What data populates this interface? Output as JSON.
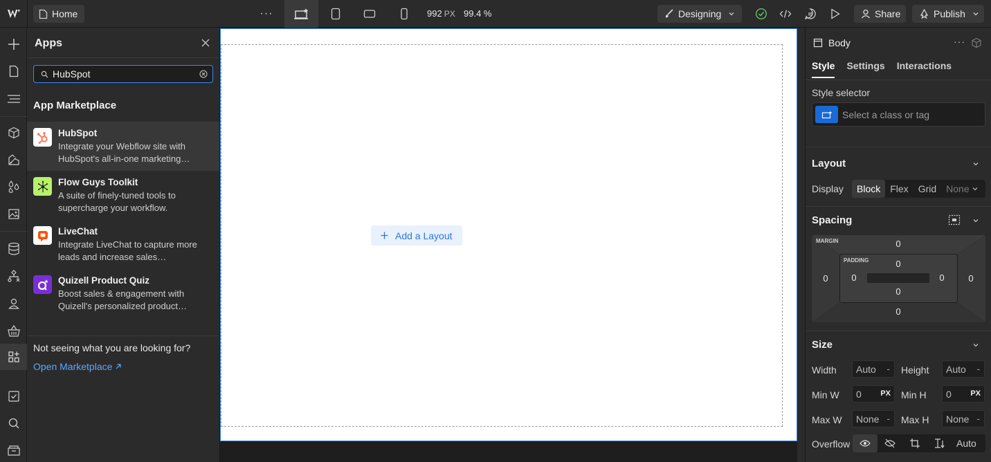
{
  "topbar": {
    "home_label": "Home",
    "more": "···",
    "viewport_width": "992",
    "viewport_unit": "PX",
    "zoom": "99.4 %",
    "mode_label": "Designing",
    "share_label": "Share",
    "publish_label": "Publish"
  },
  "apps_panel": {
    "title": "Apps",
    "search_value": "HubSpot",
    "section_title": "App Marketplace",
    "items": [
      {
        "name": "HubSpot",
        "desc": "Integrate your Webflow site with HubSpot's all-in-one marketing…",
        "color": "#ff7a59"
      },
      {
        "name": "Flow Guys Toolkit",
        "desc": "A suite of finely-tuned tools to supercharge your workflow.",
        "color": "#b7f06b"
      },
      {
        "name": "LiveChat",
        "desc": "Integrate LiveChat to capture more leads and increase sales…",
        "color": "#ff5100"
      },
      {
        "name": "Quizell Product Quiz",
        "desc": "Boost sales & engagement with Quizell's personalized product…",
        "color": "#7a2fd6"
      }
    ],
    "footer_text": "Not seeing what you are looking for?",
    "footer_link": "Open Marketplace"
  },
  "canvas": {
    "add_layout_label": "Add a Layout"
  },
  "right_panel": {
    "selected": "Body",
    "more": "···",
    "tabs": [
      "Style",
      "Settings",
      "Interactions"
    ],
    "style_selector_label": "Style selector",
    "style_selector_placeholder": "Select a class or tag",
    "layout": {
      "title": "Layout",
      "display_label": "Display",
      "options": [
        "Block",
        "Flex",
        "Grid",
        "None"
      ]
    },
    "spacing": {
      "title": "Spacing",
      "margin_label": "MARGIN",
      "padding_label": "PADDING",
      "margin": {
        "top": "0",
        "right": "0",
        "bottom": "0",
        "left": "0"
      },
      "padding": {
        "top": "0",
        "right": "0",
        "bottom": "0",
        "left": "0"
      }
    },
    "size": {
      "title": "Size",
      "width_label": "Width",
      "width_value": "Auto",
      "height_label": "Height",
      "height_value": "Auto",
      "minw_label": "Min W",
      "minw_value": "0",
      "minw_unit": "PX",
      "minh_label": "Min H",
      "minh_value": "0",
      "minh_unit": "PX",
      "maxw_label": "Max W",
      "maxw_value": "None",
      "maxh_label": "Max H",
      "maxh_value": "None",
      "dash": "-",
      "overflow_label": "Overflow",
      "overflow_auto": "Auto"
    }
  }
}
